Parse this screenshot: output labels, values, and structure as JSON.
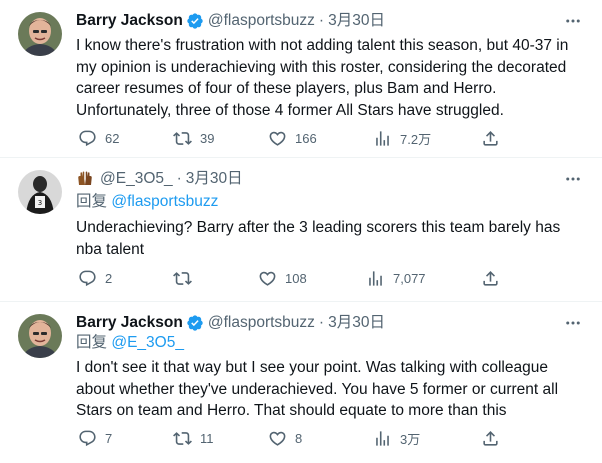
{
  "tweets": [
    {
      "author": "Barry Jackson",
      "handle": "@flasportsbuzz",
      "separator": "·",
      "time": "3月30日",
      "reply_prefix": "",
      "reply_mention": "",
      "text": "I know there's frustration with not adding talent this season, but 40-37 in my opinion is underachieving with this roster, considering the decorated career resumes of four of these players, plus Bam and Herro. Unfortunately, three of those 4 former All Stars have struggled.",
      "replies": "62",
      "retweets": "39",
      "likes": "166",
      "views": "7.2万"
    },
    {
      "author": "",
      "handle": "@E_3O5_",
      "separator": "·",
      "time": "3月30日",
      "reply_prefix": "回复",
      "reply_mention": "@flasportsbuzz",
      "text": "Underachieving? Barry after the 3 leading scorers this team barely has nba talent",
      "replies": "2",
      "retweets": "",
      "likes": "108",
      "views": "7,077"
    },
    {
      "author": "Barry Jackson",
      "handle": "@flasportsbuzz",
      "separator": "·",
      "time": "3月30日",
      "reply_prefix": "回复",
      "reply_mention": "@E_3O5_",
      "text": "I don't see it that way but I see your point. Was talking with colleague about whether they've underachieved. You have 5 former or current all Stars on team and Herro. That should equate to more than this",
      "replies": "7",
      "retweets": "11",
      "likes": "8",
      "views": "3万"
    }
  ],
  "colors": {
    "accent": "#1d9bf0",
    "muted": "#536471",
    "text": "#0f1419",
    "verified": "#1d9bf0"
  }
}
